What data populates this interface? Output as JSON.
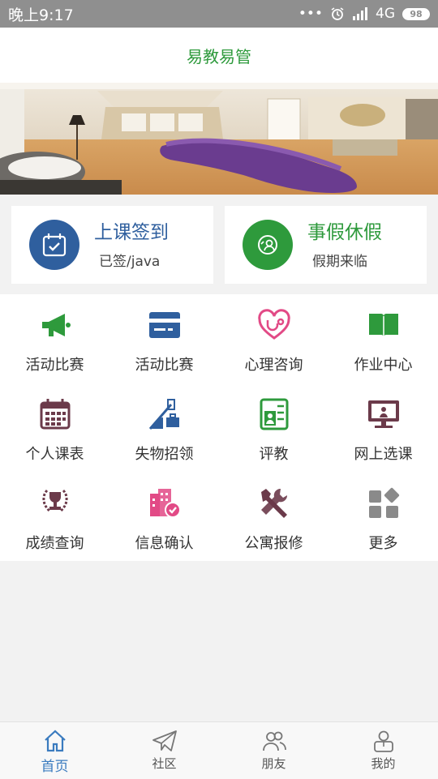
{
  "status_bar": {
    "time": "晚上9:17",
    "signal": "4G",
    "battery": "98"
  },
  "header": {
    "title": "易教易管"
  },
  "quick_cards": [
    {
      "title": "上课签到",
      "subtitle": "已签/java",
      "icon": "calendar-check-icon",
      "color": "#2f5f9e"
    },
    {
      "title": "事假休假",
      "subtitle": "假期来临",
      "icon": "person-leave-icon",
      "color": "#2e9a3c"
    }
  ],
  "grid": [
    {
      "label": "活动比赛",
      "icon": "megaphone-icon"
    },
    {
      "label": "活动比赛",
      "icon": "card-icon"
    },
    {
      "label": "心理咨询",
      "icon": "heart-stethoscope-icon"
    },
    {
      "label": "作业中心",
      "icon": "book-icon"
    },
    {
      "label": "个人课表",
      "icon": "calendar-icon"
    },
    {
      "label": "失物招领",
      "icon": "lost-found-icon"
    },
    {
      "label": "评教",
      "icon": "evaluation-icon"
    },
    {
      "label": "网上选课",
      "icon": "monitor-icon"
    },
    {
      "label": "成绩查询",
      "icon": "trophy-icon"
    },
    {
      "label": "信息确认",
      "icon": "building-check-icon"
    },
    {
      "label": "公寓报修",
      "icon": "tools-icon"
    },
    {
      "label": "更多",
      "icon": "more-icon"
    }
  ],
  "tabs": [
    {
      "label": "首页",
      "icon": "home-icon",
      "active": true
    },
    {
      "label": "社区",
      "icon": "paper-plane-icon"
    },
    {
      "label": "朋友",
      "icon": "friends-icon"
    },
    {
      "label": "我的",
      "icon": "profile-icon"
    }
  ],
  "colors": {
    "brand_green": "#2e9a3c",
    "brand_blue": "#2f5f9e",
    "tab_active": "#3a7bbf"
  }
}
